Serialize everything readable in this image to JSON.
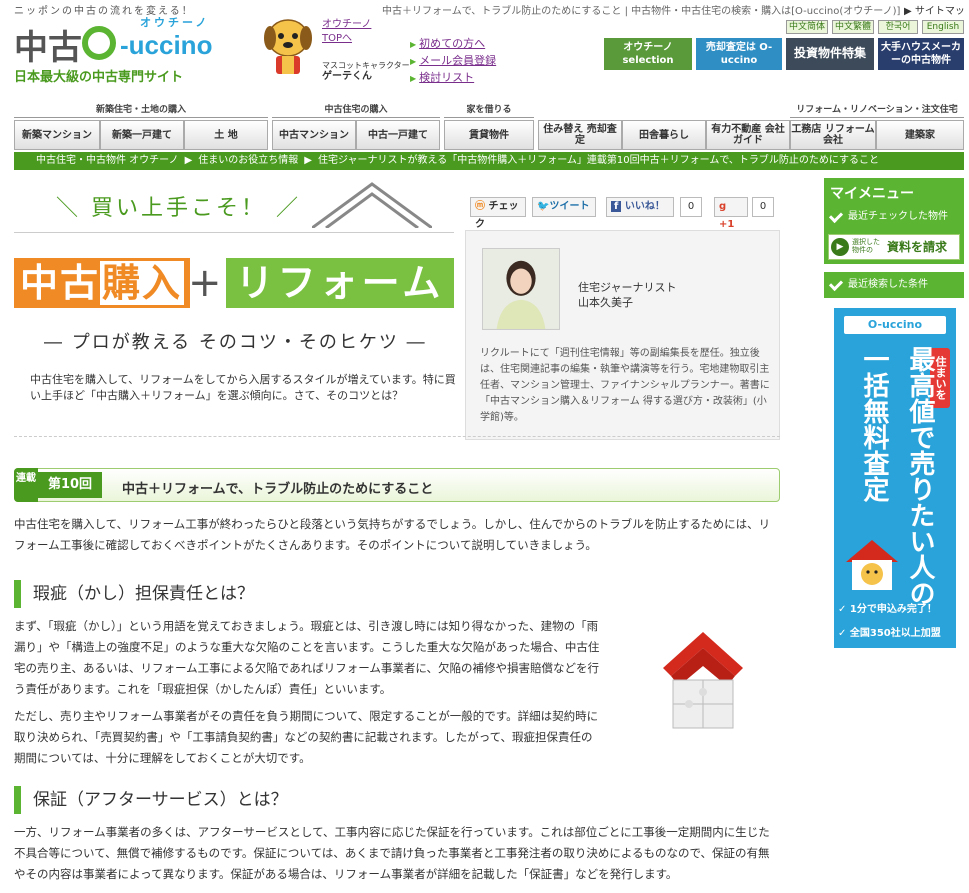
{
  "header": {
    "tagline": "ニッポンの中古の流れを変える！",
    "top_breadcrumb": "中古＋リフォームで、トラブル防止のためにすること | 中古物件・中古住宅の検索・購入は[O-uccino(オウチーノ)]",
    "sitemap": "▶ サイトマップ",
    "logo_kanji": "中古",
    "logo_kana": "オウチーノ",
    "logo_word": "-uccino",
    "logo_sub": "日本最大級の中古専門サイト",
    "mascot_caption": "マスコットキャラクター",
    "mascot_name": "ゲーテくん",
    "top_link": "オウチーノ TOPへ",
    "links": [
      "初めての方へ",
      "メール会員登録",
      "検討リスト"
    ],
    "languages": [
      "中文简体",
      "中文繁體",
      "한국어",
      "English"
    ],
    "banners": [
      "オウチーノ selection",
      "売却査定は O-uccino",
      "投資物件特集",
      "大手ハウスメーカーの中古物件"
    ]
  },
  "nav": {
    "groups": [
      "新築住宅・土地の購入",
      "中古住宅の購入",
      "家を借りる",
      "リフォーム・リノベーション・注文住宅"
    ],
    "buttons": [
      "新築マンション",
      "新築一戸建て",
      "土 地",
      "中古マンション",
      "中古一戸建て",
      "賃貸物件",
      "住み替え 売却査定",
      "田舎暮らし",
      "有力不動産 会社ガイド",
      "工務店 リフォーム会社",
      "建築家"
    ]
  },
  "breadcrumb": [
    "中古住宅・中古物件 オウチーノ",
    "住まいのお役立ち情報",
    "住宅ジャーナリストが教える「中古物件購入＋リフォーム」連載第10回中古＋リフォームで、トラブル防止のためにすること"
  ],
  "hero": {
    "kicker": "＼ 買い上手こそ！ ／",
    "title_a": "中古",
    "title_b": "購入",
    "plus": "+",
    "title_c": "リフォーム",
    "subtitle": "― プロが教える そのコツ・そのヒケツ ―",
    "intro": "中古住宅を購入して、リフォームをしてから入居するスタイルが増えています。特に買い上手ほど「中古購入＋リフォーム」を選ぶ傾向に。さて、そのコツとは？"
  },
  "social": {
    "check": "チェック",
    "tweet": "ツイート",
    "like": "いいね！",
    "like_count": "0",
    "plusone": "+1",
    "plusone_count": "0"
  },
  "author": {
    "role": "住宅ジャーナリスト",
    "name": "山本久美子",
    "bio": "リクルートにて「週刊住宅情報」等の副編集長を歴任。独立後は、住宅関連記事の編集・執筆や講演等を行う。宅地建物取引主任者、マンション管理士、ファイナンシャルプランナー。著書に「中古マンション購入＆リフォーム 得する選び方・改装術」(小学館)等。"
  },
  "article": {
    "series_label": "連載",
    "episode": "第10回",
    "title": "中古＋リフォームで、トラブル防止のためにすること",
    "lead": "中古住宅を購入して、リフォーム工事が終わったらひと段落という気持ちがするでしょう。しかし、住んでからのトラブルを防止するためには、リフォーム工事後に確認しておくべきポイントがたくさんあります。そのポイントについて説明していきましょう。",
    "sec1_title": "瑕疵（かし）担保責任とは？",
    "sec1_p1": "まず、「瑕疵（かし）」という用語を覚えておきましょう。瑕疵とは、引き渡し時には知り得なかった、建物の「雨漏り」や「構造上の強度不足」のような重大な欠陥のことを言います。こうした重大な欠陥があった場合、中古住宅の売り主、あるいは、リフォーム工事による欠陥であればリフォーム事業者に、欠陥の補修や損害賠償などを行う責任があります。これを「瑕疵担保（かしたんぽ）責任」といいます。",
    "sec1_p2": "ただし、売り主やリフォーム事業者がその責任を負う期間について、限定することが一般的です。詳細は契約時に取り決められ、「売買契約書」や「工事請負契約書」などの契約書に記載されます。したがって、瑕疵担保責任の期間については、十分に理解をしておくことが大切です。",
    "sec2_title": "保証（アフターサービス）とは？",
    "sec2_p1": "一方、リフォーム事業者の多くは、アフターサービスとして、工事内容に応じた保証を行っています。これは部位ごとに工事後一定期間内に生じた不具合等について、無償で補修するものです。保証については、あくまで請け負った事業者と工事発注者の取り決めによるものなので、保証の有無やその内容は事業者によって異なります。保証がある場合は、リフォーム事業者が詳細を記載した「保証書」などを発行します。"
  },
  "sidebar": {
    "menu_title": "マイメニュー",
    "recent_checked": "最近チェックした物件",
    "request_small": "選択した 物件の",
    "request": "資料を請求",
    "recent_search": "最近検索した条件",
    "ad_logo": "O-uccino",
    "ad_tag": "住まいを",
    "ad_col1": "一括無料査定",
    "ad_col2": "最高値で売りたい人の",
    "ad_line1": "✓ 1分で申込み完了！",
    "ad_line2": "✓ 全国350社以上加盟"
  }
}
